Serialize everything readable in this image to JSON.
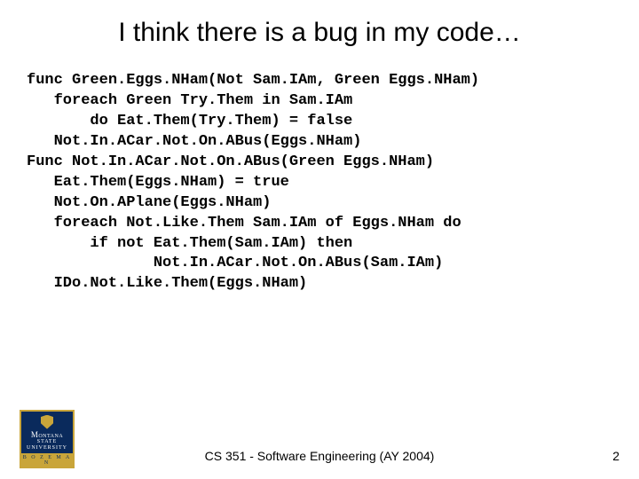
{
  "slide": {
    "title": "I think there is a bug in my code…",
    "code": "func Green.Eggs.NHam(Not Sam.IAm, Green Eggs.NHam)\n   foreach Green Try.Them in Sam.IAm\n       do Eat.Them(Try.Them) = false\n   Not.In.ACar.Not.On.ABus(Eggs.NHam)\nFunc Not.In.ACar.Not.On.ABus(Green Eggs.NHam)\n   Eat.Them(Eggs.NHam) = true\n   Not.On.APlane(Eggs.NHam)\n   foreach Not.Like.Them Sam.IAm of Eggs.NHam do\n       if not Eat.Them(Sam.IAm) then\n              Not.In.ACar.Not.On.ABus(Sam.IAm)\n   IDo.Not.Like.Them(Eggs.NHam)",
    "footer": "CS 351 - Software Engineering (AY 2004)",
    "page_number": "2"
  },
  "logo": {
    "line1": "Montana",
    "line2": "STATE UNIVERSITY",
    "line3": "B O Z E M A N"
  }
}
